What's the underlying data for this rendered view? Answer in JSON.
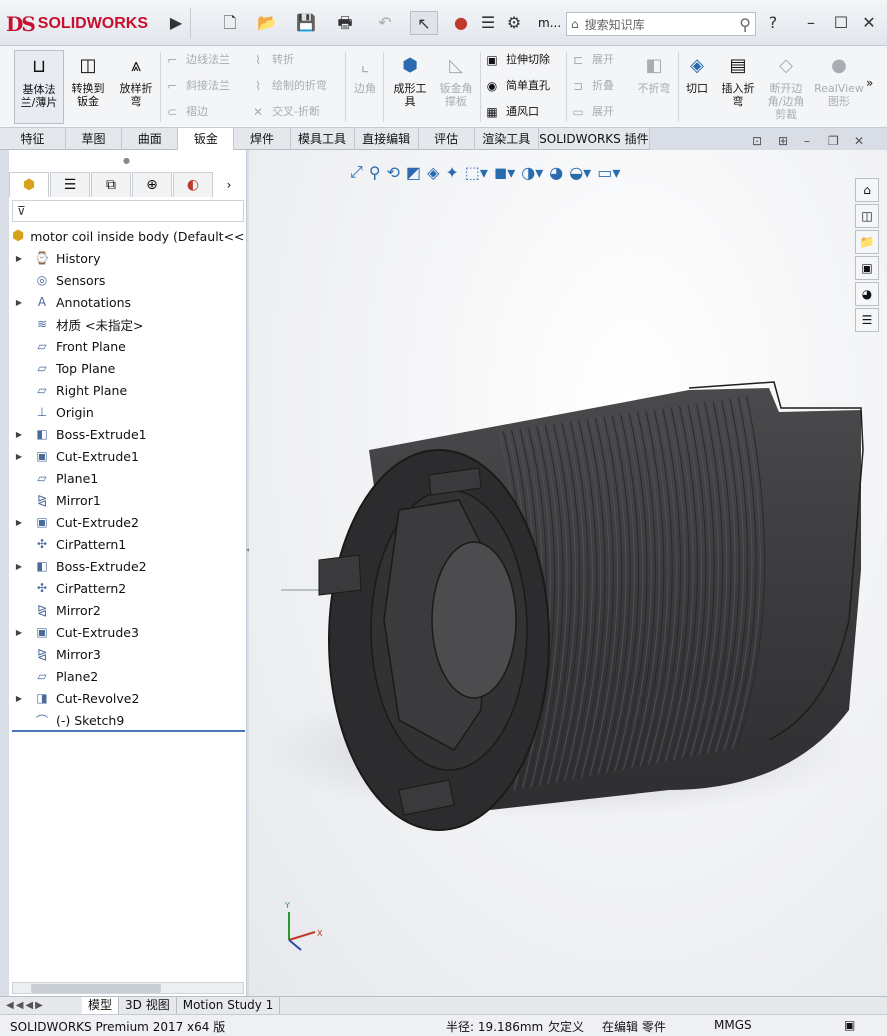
{
  "app": {
    "logo_ds": "DS",
    "logo_text": "SOLIDWORKS",
    "search_placeholder": "搜索知识库",
    "user_menu": "m..."
  },
  "ribbon": {
    "big_buttons": [
      {
        "label": "基体法\n兰/薄片",
        "icon": "base-flange-icon"
      },
      {
        "label": "转换到\n钣金",
        "icon": "convert-sheet-metal-icon"
      },
      {
        "label": "放样折\n弯",
        "icon": "lofted-bend-icon"
      }
    ],
    "group1": [
      {
        "label": "边线法兰",
        "icon": "edge-flange-icon"
      },
      {
        "label": "斜接法兰",
        "icon": "miter-flange-icon"
      },
      {
        "label": "褶边",
        "icon": "hem-icon"
      }
    ],
    "group2": [
      {
        "label": "转折",
        "icon": "jog-icon"
      },
      {
        "label": "绘制的折弯",
        "icon": "sketched-bend-icon"
      },
      {
        "label": "交叉-折断",
        "icon": "cross-break-icon"
      }
    ],
    "corner": "边角",
    "forming": "成形工\n具",
    "gusset": "钣金角\n撑板",
    "group3": [
      {
        "label": "拉伸切除",
        "icon": "extruded-cut-icon"
      },
      {
        "label": "简单直孔",
        "icon": "simple-hole-icon"
      },
      {
        "label": "通风口",
        "icon": "vent-icon"
      }
    ],
    "group4": [
      {
        "label": "展开",
        "icon": "unfold-icon"
      },
      {
        "label": "折叠",
        "icon": "fold-icon"
      },
      {
        "label": "展开",
        "icon": "flatten-icon"
      }
    ],
    "no_bends": "不折弯",
    "cut": "切口",
    "insert_bends": "插入折\n弯",
    "break_corner": "断开边\n角/边角\n剪裁",
    "realview": "RealView\n图形"
  },
  "tabs": [
    "特征",
    "草图",
    "曲面",
    "钣金",
    "焊件",
    "模具工具",
    "直接编辑",
    "评估",
    "渲染工具",
    "SOLIDWORKS 插件"
  ],
  "active_tab": "钣金",
  "tree": {
    "root": "motor  coil inside body  (Default<<D",
    "items": [
      {
        "label": "History",
        "expandable": true,
        "icon": "history-icon"
      },
      {
        "label": "Sensors",
        "expandable": false,
        "icon": "sensors-icon"
      },
      {
        "label": "Annotations",
        "expandable": true,
        "icon": "annotations-icon"
      },
      {
        "label": "材质 <未指定>",
        "expandable": false,
        "icon": "material-icon"
      },
      {
        "label": "Front Plane",
        "expandable": false,
        "icon": "plane-icon"
      },
      {
        "label": "Top Plane",
        "expandable": false,
        "icon": "plane-icon"
      },
      {
        "label": "Right Plane",
        "expandable": false,
        "icon": "plane-icon"
      },
      {
        "label": "Origin",
        "expandable": false,
        "icon": "origin-icon"
      },
      {
        "label": "Boss-Extrude1",
        "expandable": true,
        "icon": "boss-extrude-icon"
      },
      {
        "label": "Cut-Extrude1",
        "expandable": true,
        "icon": "cut-extrude-icon"
      },
      {
        "label": "Plane1",
        "expandable": false,
        "icon": "plane-icon"
      },
      {
        "label": "Mirror1",
        "expandable": false,
        "icon": "mirror-icon"
      },
      {
        "label": "Cut-Extrude2",
        "expandable": true,
        "icon": "cut-extrude-icon"
      },
      {
        "label": "CirPattern1",
        "expandable": false,
        "icon": "circular-pattern-icon"
      },
      {
        "label": "Boss-Extrude2",
        "expandable": true,
        "icon": "boss-extrude-icon"
      },
      {
        "label": "CirPattern2",
        "expandable": false,
        "icon": "circular-pattern-icon"
      },
      {
        "label": "Mirror2",
        "expandable": false,
        "icon": "mirror-icon"
      },
      {
        "label": "Cut-Extrude3",
        "expandable": true,
        "icon": "cut-extrude-icon"
      },
      {
        "label": "Mirror3",
        "expandable": false,
        "icon": "mirror-icon"
      },
      {
        "label": "Plane2",
        "expandable": false,
        "icon": "plane-icon"
      },
      {
        "label": "Cut-Revolve2",
        "expandable": true,
        "icon": "cut-revolve-icon"
      },
      {
        "label": "(-) Sketch9",
        "expandable": false,
        "icon": "sketch-icon"
      }
    ]
  },
  "triad": {
    "y": "Y",
    "x": "X"
  },
  "bottom_tabs": [
    "模型",
    "3D 视图",
    "Motion Study 1"
  ],
  "status": {
    "product": "SOLIDWORKS Premium 2017 x64 版",
    "radius": "半径: 19.186mm",
    "definition": "欠定义",
    "mode": "在编辑 零件",
    "units": "MMGS"
  },
  "colors": {
    "brand": "#c8102e",
    "model": "#3a3a3c",
    "accent": "#4a78b8"
  }
}
